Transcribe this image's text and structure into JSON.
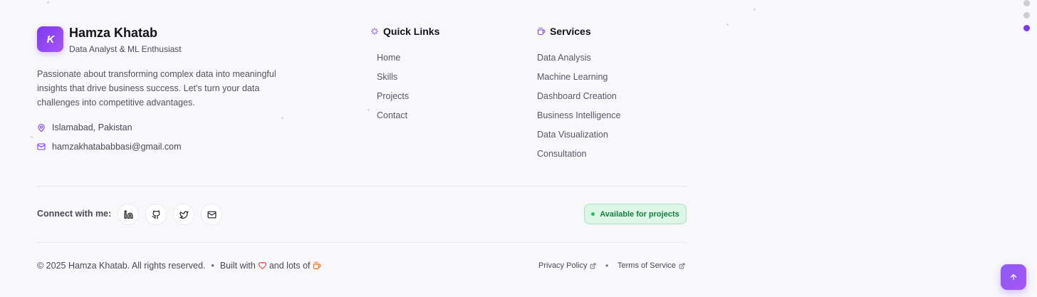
{
  "brand": {
    "logo_text": "K",
    "name": "Hamza Khatab",
    "role": "Data Analyst & ML Enthusiast",
    "bio": "Passionate about transforming complex data into meaningful insights that drive business success. Let's turn your data challenges into competitive advantages.",
    "location": "Islamabad, Pakistan",
    "email": "hamzakhatababbasi@gmail.com"
  },
  "quick_links": {
    "title": "Quick Links",
    "icon": "sparkles-icon",
    "items": [
      "Home",
      "Skills",
      "Projects",
      "Contact"
    ]
  },
  "services": {
    "title": "Services",
    "icon": "coffee-icon",
    "items": [
      "Data Analysis",
      "Machine Learning",
      "Dashboard Creation",
      "Business Intelligence",
      "Data Visualization",
      "Consultation"
    ]
  },
  "connect": {
    "label": "Connect with me:",
    "socials": [
      "linkedin-icon",
      "github-icon",
      "twitter-icon",
      "mail-icon"
    ],
    "availability": "Available for projects"
  },
  "footer": {
    "copyright": "© 2025 Hamza Khatab. All rights reserved.",
    "bullet": "•",
    "built_with": "Built with",
    "and_lots_of": "and lots of",
    "privacy": "Privacy Policy",
    "terms": "Terms of Service"
  },
  "colors": {
    "accent": "#7c3aed",
    "available_green": "#16803c",
    "heart_red": "#ef4444",
    "coffee_orange": "#f97316"
  }
}
